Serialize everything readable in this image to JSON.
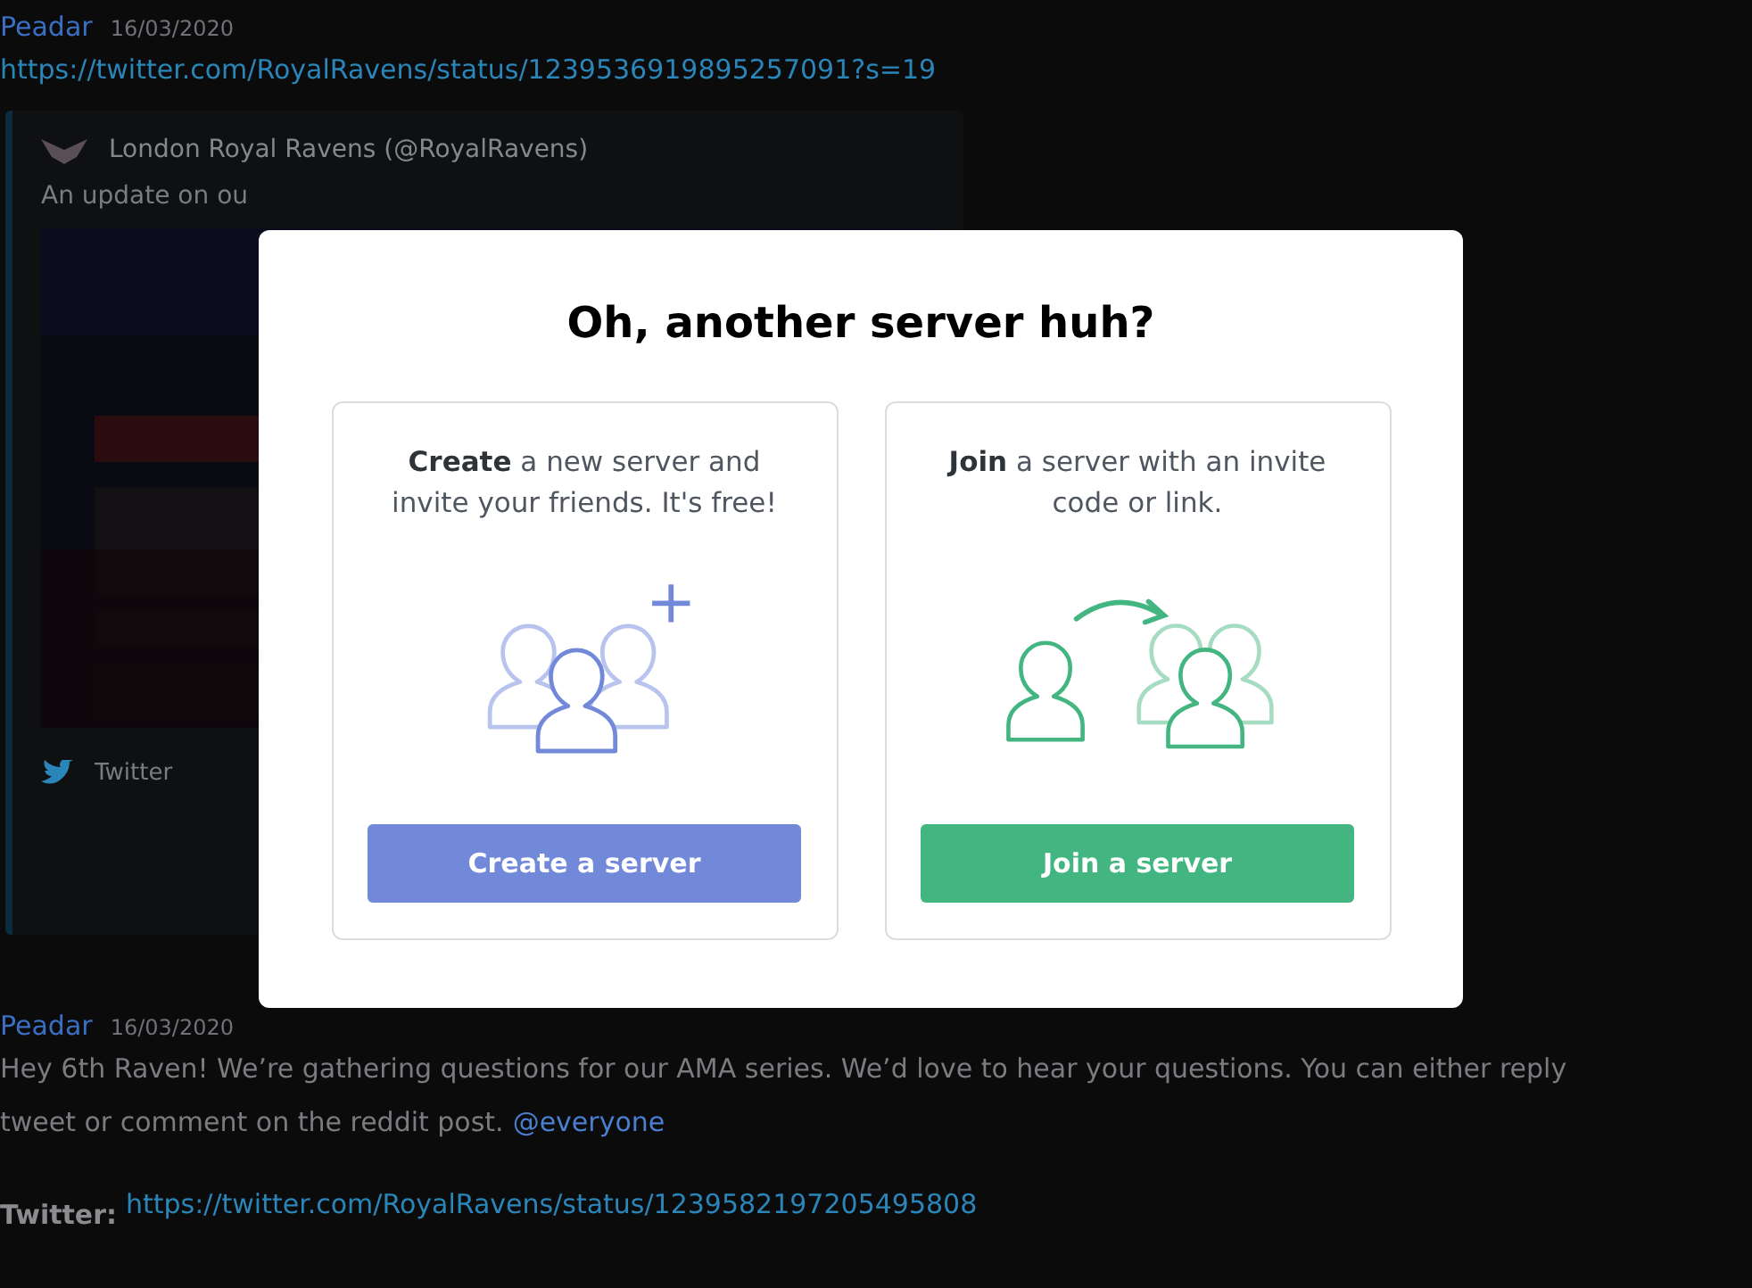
{
  "messages": [
    {
      "author": "Peadar",
      "date": "16/03/2020",
      "link": "https://twitter.com/RoyalRavens/status/1239536919895257091?s=19",
      "embed": {
        "author": "London Royal Ravens (@RoyalRavens)",
        "description": "An update on ou",
        "kind": "picture",
        "footer": "Twitter"
      }
    },
    {
      "author": "Peadar",
      "date": "16/03/2020",
      "lines": [
        "Hey 6th Raven! We’re gathering questions for our AMA series. We’d love to hear your questions. You can either reply"
      ],
      "tail": "tweet or comment on the reddit post.",
      "mention": "@everyone",
      "label": "Twitter:",
      "link": "https://twitter.com/RoyalRavens/status/1239582197205495808"
    }
  ],
  "modal": {
    "title": "Oh, another server huh?",
    "options": [
      {
        "kind": "create",
        "bold": "Create",
        "text": " a new server and invite your friends. It's free!",
        "button": "Create a server"
      },
      {
        "kind": "join",
        "bold": "Join",
        "text": " a server with an invite code or link.",
        "button": "Join a server"
      }
    ]
  }
}
